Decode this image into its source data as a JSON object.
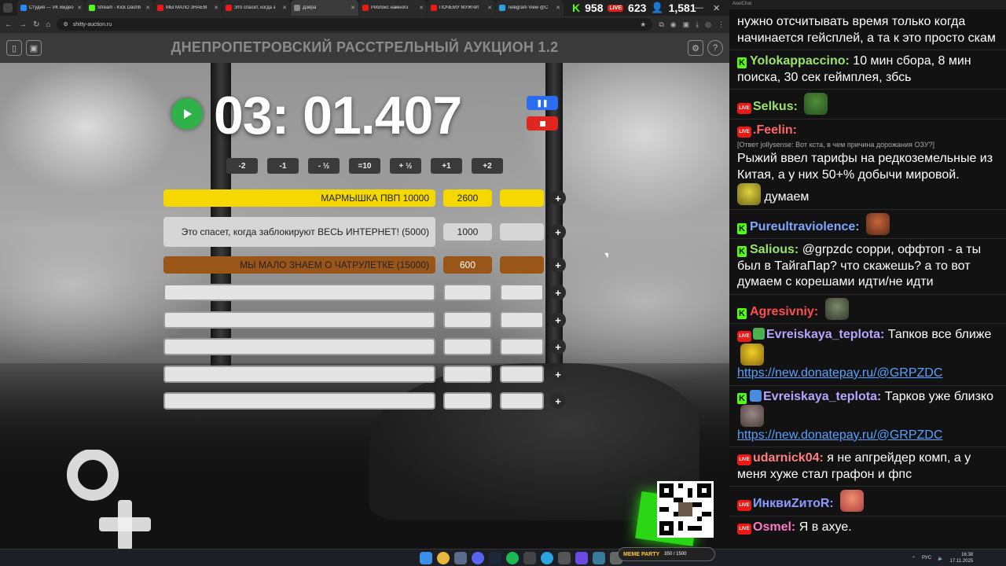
{
  "browser": {
    "tabs": [
      {
        "title": "Студия — VK Видео",
        "fav": "#2787f5"
      },
      {
        "title": "Stream - Kick Dashb",
        "fav": "#53fc18"
      },
      {
        "title": "МЫ МАЛО ЗНАЕМ",
        "fav": "#e91916"
      },
      {
        "title": "Это спасет, когда з",
        "fav": "#e91916"
      },
      {
        "title": "Дзёра",
        "fav": "#8a8a8a"
      },
      {
        "title": "Роблокс намного",
        "fav": "#e91916"
      },
      {
        "title": "ПОЧЕМУ МУЖЧИ",
        "fav": "#e91916"
      },
      {
        "title": "Telegram View @C",
        "fav": "#2aa3e0"
      }
    ],
    "active_tab_index": 4,
    "url": "shitty-auction.ru",
    "stats": {
      "kick": "958",
      "twitch": "623",
      "total": "1,581"
    }
  },
  "auction": {
    "title": "ДНЕПРОПЕТРОВСКИЙ РАССТРЕЛЬНЫЙ АУКЦИОН 1.2",
    "timer": "03: 01.407",
    "pause_label": "❚❚",
    "time_buttons": [
      "-2",
      "-1",
      "- ½",
      "=10",
      "+ ½",
      "+1",
      "+2"
    ],
    "lots": [
      {
        "name": "МАРМЫШКА ПВП 10000",
        "amount": "2600",
        "color": "#f4d800"
      },
      {
        "name": "Это спасет, когда заблокируют ВЕСЬ ИНТЕРНЕТ! (5000)",
        "amount": "1000",
        "color": "#d6d6d6"
      },
      {
        "name": "МЫ МАЛО ЗНАЕМ О ЧАТРУЛЕТКЕ (15000)",
        "amount": "600",
        "color": "#9a5618"
      },
      {
        "name": "",
        "amount": ""
      },
      {
        "name": "",
        "amount": ""
      },
      {
        "name": "",
        "amount": ""
      },
      {
        "name": "",
        "amount": ""
      },
      {
        "name": "",
        "amount": ""
      }
    ],
    "plus_label": "+"
  },
  "chat": {
    "window_title": "AxelChat",
    "messages": [
      {
        "platform": "",
        "user": "",
        "user_color": "#fff",
        "text": "нужно отсчитывать время только когда начинается гейсплей, а та к это просто скам"
      },
      {
        "platform": "kick",
        "user": "Yolokappaccino:",
        "user_color": "#9be36b",
        "text": "10 мин сбора, 8 мин поиска, 30 сек геймплея, збсь"
      },
      {
        "platform": "twitch",
        "user": "Selkus:",
        "user_color": "#9be36b",
        "text": ""
      },
      {
        "platform": "twitch",
        "user": ".Feelin:",
        "user_color": "#ff6666",
        "reply": "[Ответ jollysense: Вот кста, в чем причина дорожания ОЗУ?]",
        "text": "Рыжий ввел тарифы на редкоземельные из Китая, а у них 50+% добычи мировой.",
        "tail": "думаем"
      },
      {
        "platform": "kick",
        "user": "Pureultraviolence:",
        "user_color": "#7fa7ff",
        "text": ""
      },
      {
        "platform": "kick",
        "user": "Salious:",
        "user_color": "#9be36b",
        "text": "@grpzdc сорри, оффтоп - а ты был в ТайгаПар? что скажешь? а то вот думаем с корешами идти/не идти"
      },
      {
        "platform": "kick",
        "user": "Agresivniy:",
        "user_color": "#ff4d4d",
        "text": ""
      },
      {
        "platform": "twitch",
        "user": "Evreiskaya_teplota:",
        "user_color": "#b9a4ff",
        "text": "Тапков все ближе",
        "link": "https://new.donatepay.ru/@GRPZDC"
      },
      {
        "platform": "kick",
        "user": "Evreiskaya_teplota:",
        "user_color": "#b9a4ff",
        "text": "Тарков уже близко",
        "link": "https://new.donatepay.ru/@GRPZDC"
      },
      {
        "platform": "twitch",
        "user": "udarnick04:",
        "user_color": "#ff7f7f",
        "text": "я не апгрейдер комп, а у меня хуже стал графон и фпс"
      },
      {
        "platform": "twitch",
        "user": "ИнквиZитоR:",
        "user_color": "#8a9cff",
        "text": ""
      },
      {
        "platform": "twitch",
        "user": "Osmel:",
        "user_color": "#ff77cc",
        "text": "Я в ахуе."
      }
    ]
  },
  "taskbar": {
    "lang": "РУС",
    "time": "16:38",
    "date": "17.11.2025",
    "meme_label": "MEME PARTY",
    "meme_progress": "350 / 1500"
  }
}
